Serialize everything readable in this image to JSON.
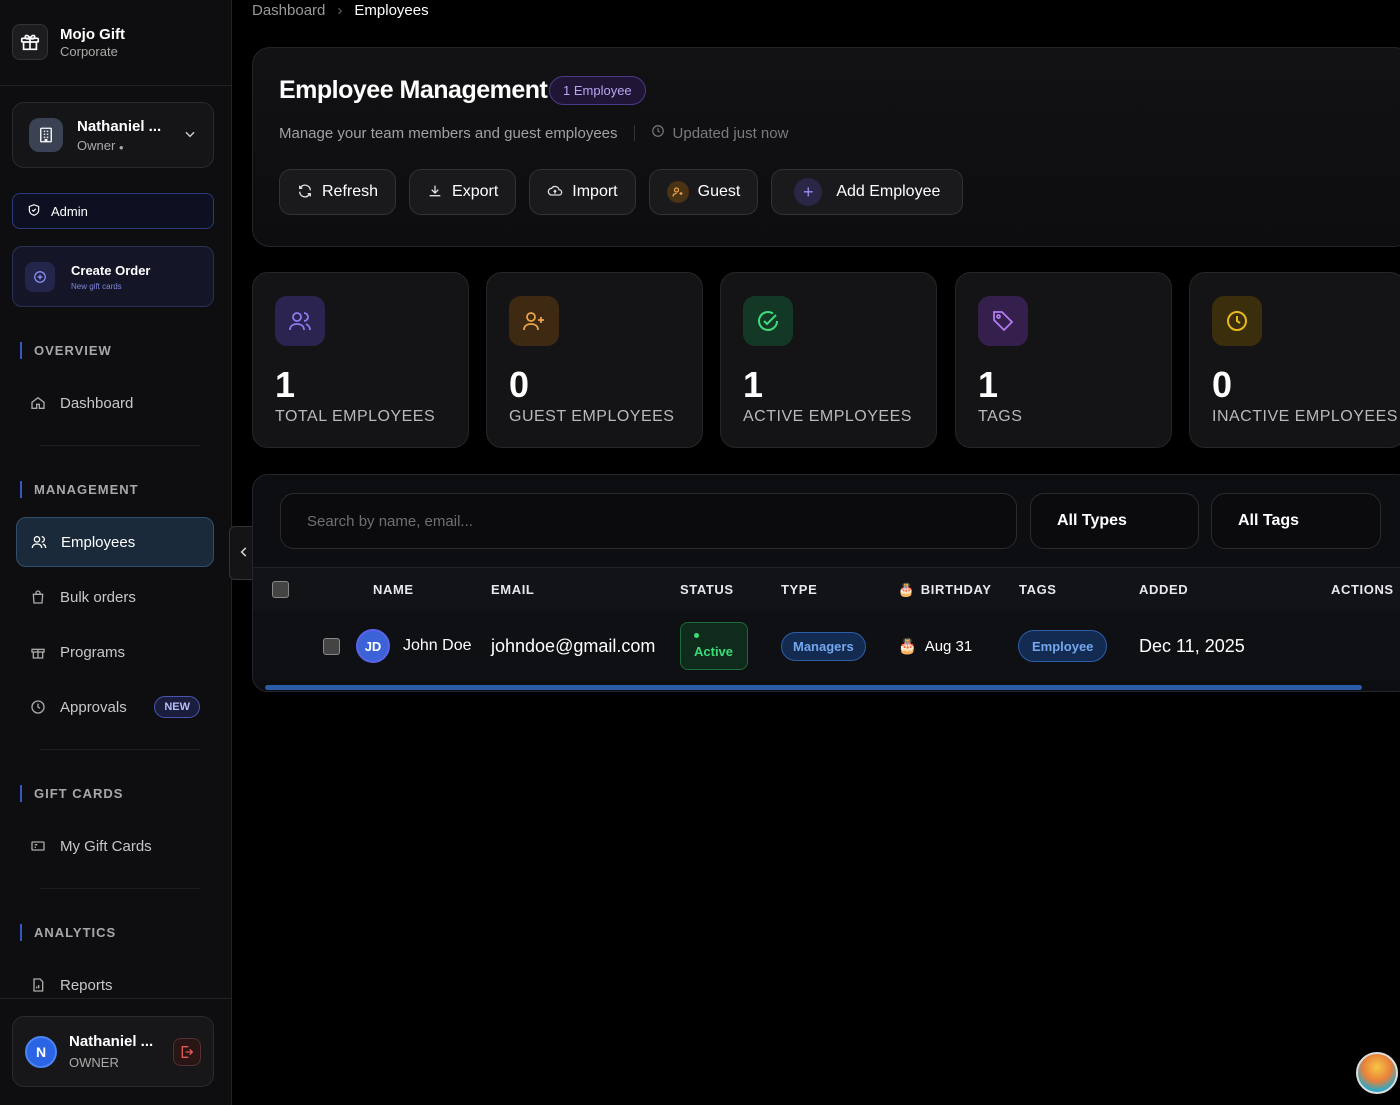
{
  "brand": {
    "title": "Mojo Gift",
    "subtitle": "Corporate"
  },
  "org": {
    "name": "Nathaniel ...",
    "role": "Owner"
  },
  "sidebar": {
    "admin_label": "Admin",
    "create_order": {
      "title": "Create Order",
      "subtitle": "New gift cards"
    },
    "sections": {
      "overview": "OVERVIEW",
      "management": "MANAGEMENT",
      "gift_cards": "GIFT CARDS",
      "analytics": "ANALYTICS"
    },
    "items": {
      "dashboard": "Dashboard",
      "employees": "Employees",
      "bulk_orders": "Bulk orders",
      "programs": "Programs",
      "approvals": "Approvals",
      "approvals_badge": "NEW",
      "my_gift_cards": "My Gift Cards",
      "reports": "Reports"
    }
  },
  "user": {
    "initial": "N",
    "name": "Nathaniel ...",
    "role": "OWNER"
  },
  "breadcrumb": {
    "parent": "Dashboard",
    "current": "Employees"
  },
  "header": {
    "title": "Employee Management",
    "count_badge": "1 Employee",
    "subtitle": "Manage your team members and guest employees",
    "updated": "Updated just now",
    "buttons": {
      "refresh": "Refresh",
      "export": "Export",
      "import": "Import",
      "guest": "Guest",
      "add_employee": "Add Employee"
    }
  },
  "stats": [
    {
      "value": "1",
      "label": "TOTAL EMPLOYEES",
      "icon": "users-icon",
      "color": "#8b7bf0"
    },
    {
      "value": "0",
      "label": "GUEST EMPLOYEES",
      "icon": "user-plus-icon",
      "color": "#e9a34b"
    },
    {
      "value": "1",
      "label": "ACTIVE EMPLOYEES",
      "icon": "check-circle-icon",
      "color": "#3ddc7a"
    },
    {
      "value": "1",
      "label": "TAGS",
      "icon": "tag-icon",
      "color": "#b27cf0"
    },
    {
      "value": "0",
      "label": "INACTIVE EMPLOYEES",
      "icon": "clock-icon",
      "color": "#e9b820"
    }
  ],
  "filters": {
    "search_placeholder": "Search by name, email...",
    "type": "All Types",
    "tags": "All Tags"
  },
  "table": {
    "columns": {
      "name": "NAME",
      "email": "EMAIL",
      "status": "STATUS",
      "type": "TYPE",
      "birthday": "BIRTHDAY",
      "tags": "TAGS",
      "added": "ADDED",
      "actions": "ACTIONS"
    },
    "rows": [
      {
        "initials": "JD",
        "name": "John Doe",
        "email": "johndoe@gmail.com",
        "status": "Active",
        "type": "Managers",
        "birthday": "Aug 31",
        "tag": "Employee",
        "added": "Dec 11, 2025"
      }
    ]
  }
}
